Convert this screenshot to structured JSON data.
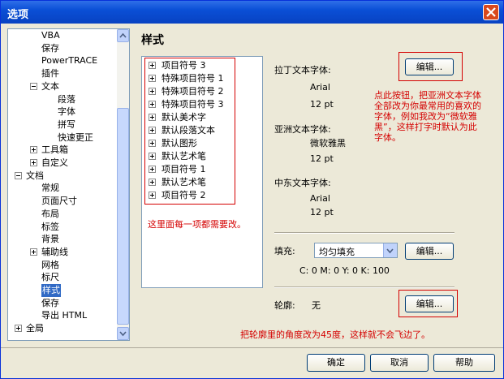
{
  "window": {
    "title": "选项"
  },
  "tree": {
    "items": [
      {
        "label": "VBA",
        "level": 2,
        "expander": "none"
      },
      {
        "label": "保存",
        "level": 2,
        "expander": "none"
      },
      {
        "label": "PowerTRACE",
        "level": 2,
        "expander": "none"
      },
      {
        "label": "插件",
        "level": 2,
        "expander": "none"
      },
      {
        "label": "文本",
        "level": 2,
        "expander": "minus"
      },
      {
        "label": "段落",
        "level": 3,
        "expander": "none"
      },
      {
        "label": "字体",
        "level": 3,
        "expander": "none"
      },
      {
        "label": "拼写",
        "level": 3,
        "expander": "none"
      },
      {
        "label": "快速更正",
        "level": 3,
        "expander": "none"
      },
      {
        "label": "工具箱",
        "level": 2,
        "expander": "plus"
      },
      {
        "label": "自定义",
        "level": 2,
        "expander": "plus"
      },
      {
        "label": "文档",
        "level": 1,
        "expander": "minus"
      },
      {
        "label": "常规",
        "level": 2,
        "expander": "none"
      },
      {
        "label": "页面尺寸",
        "level": 2,
        "expander": "none"
      },
      {
        "label": "布局",
        "level": 2,
        "expander": "none"
      },
      {
        "label": "标签",
        "level": 2,
        "expander": "none"
      },
      {
        "label": "背景",
        "level": 2,
        "expander": "none"
      },
      {
        "label": "辅助线",
        "level": 2,
        "expander": "plus"
      },
      {
        "label": "网格",
        "level": 2,
        "expander": "none"
      },
      {
        "label": "标尺",
        "level": 2,
        "expander": "none"
      },
      {
        "label": "样式",
        "level": 2,
        "expander": "none",
        "selected": true
      },
      {
        "label": "保存",
        "level": 2,
        "expander": "none"
      },
      {
        "label": "导出 HTML",
        "level": 2,
        "expander": "none"
      },
      {
        "label": "全局",
        "level": 1,
        "expander": "plus"
      }
    ]
  },
  "panel": {
    "title": "样式"
  },
  "style_list": [
    "项目符号 3",
    "特殊项目符号 1",
    "特殊项目符号 2",
    "特殊项目符号 3",
    "默认美术字",
    "默认段落文本",
    "默认图形",
    "默认艺术笔",
    "项目符号 1",
    "默认艺术笔",
    "项目符号 2"
  ],
  "annotations": {
    "list_note": "这里面每一项都需要改。",
    "font_note": [
      "点此按钮，把亚洲文本字体",
      "全部改为你最常用的喜欢的",
      "字体，例如我改为“微软雅",
      "黑”，这样打字时默认为此",
      "字体。"
    ],
    "outline_note": "把轮廓里的角度改为45度，这样就不会飞边了。"
  },
  "fonts": {
    "latin_label": "拉丁文本字体:",
    "latin_font": "Arial",
    "latin_size": "12 pt",
    "asian_label": "亚洲文本字体:",
    "asian_font": "微软雅黑",
    "asian_size": "12 pt",
    "me_label": "中东文本字体:",
    "me_font": "Arial",
    "me_size": "12 pt",
    "edit_label": "编辑..."
  },
  "fill": {
    "label": "填充:",
    "value": "均匀填充",
    "color_text": "C: 0 M: 0 Y: 0 K: 100",
    "edit_label": "编辑..."
  },
  "outline": {
    "label": "轮廓:",
    "value": "无",
    "edit_label": "编辑..."
  },
  "buttons": {
    "ok": "确定",
    "cancel": "取消",
    "help": "帮助"
  },
  "colors": {
    "accent": "#316ac5",
    "annotation": "#d40000",
    "titlebar": "#0a4fd6"
  }
}
